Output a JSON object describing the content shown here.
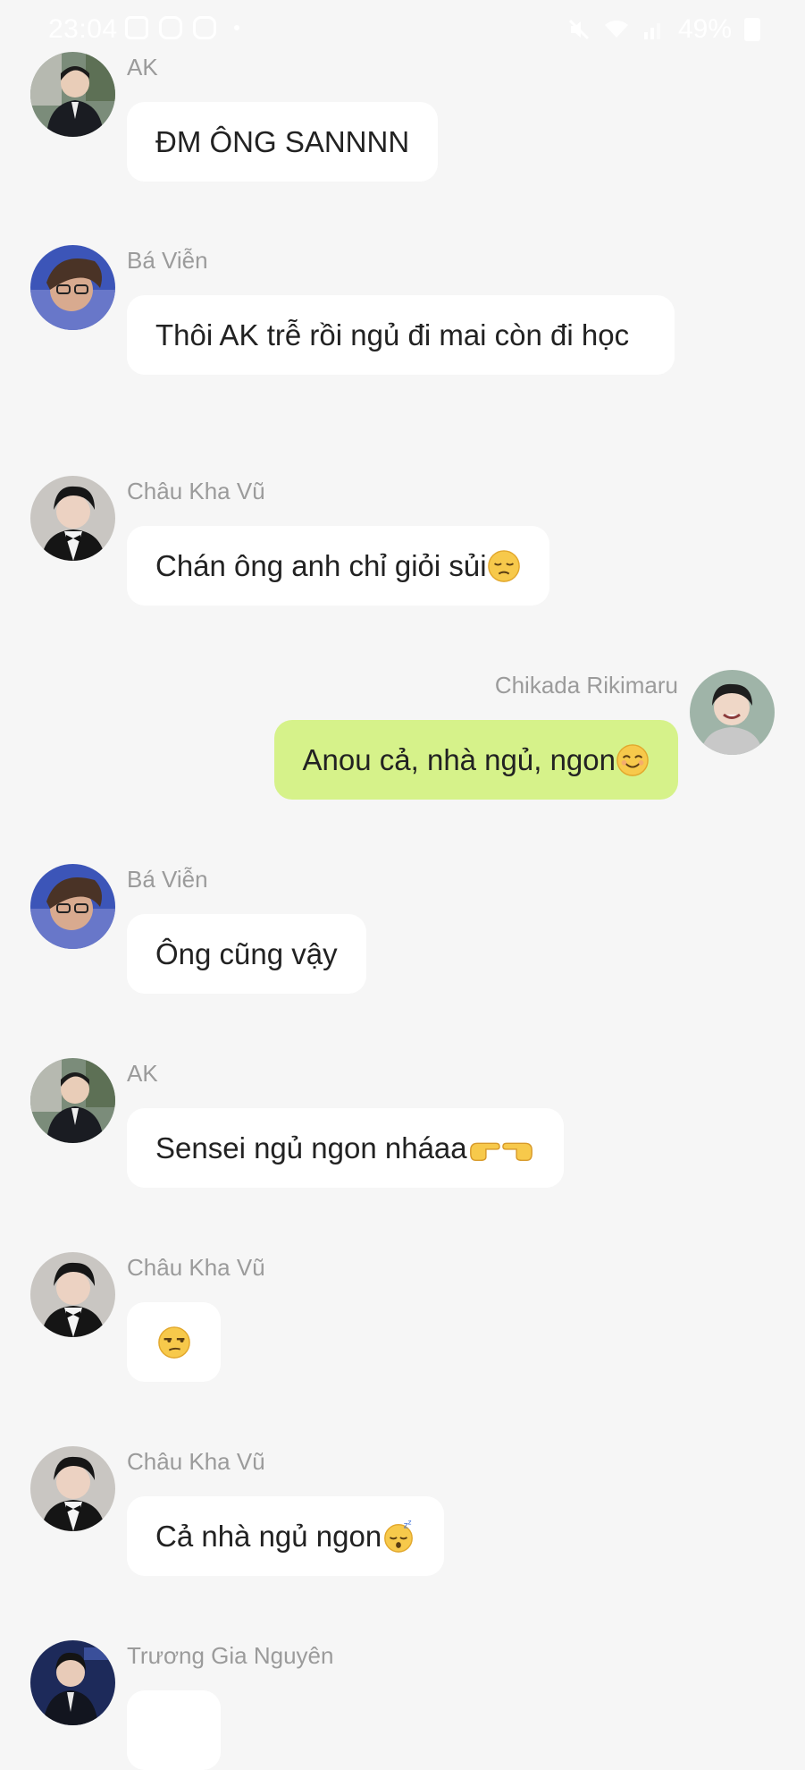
{
  "status_bar": {
    "time": "23:04",
    "battery": "49%",
    "icons_left": [
      "gallery-icon",
      "instagram-icon",
      "instagram-icon",
      "dot-icon"
    ],
    "icons_right": [
      "mute-icon",
      "wifi-icon",
      "signal-icon",
      "battery-icon"
    ]
  },
  "colors": {
    "background": "#f6f6f6",
    "bubble_incoming": "#ffffff",
    "bubble_outgoing": "#d6f28a",
    "sender_name": "#9b9b9b",
    "text": "#222222"
  },
  "messages": [
    {
      "sender": "AK",
      "side": "left",
      "text": "ĐM ÔNG SANNNN"
    },
    {
      "sender": "Bá Viễn",
      "side": "left",
      "text": "Thôi AK trễ rồi ngủ đi mai còn đi học"
    },
    {
      "sender": "Châu Kha Vũ",
      "side": "left",
      "text": "Chán ông anh chỉ giỏi sủi",
      "emoji": "pensive-face-emoji"
    },
    {
      "sender": "Chikada Rikimaru",
      "side": "right",
      "text": "Anou cả, nhà ngủ, ngon",
      "emoji": "smiling-face-emoji"
    },
    {
      "sender": "Bá Viễn",
      "side": "left",
      "text": "Ông cũng vậy"
    },
    {
      "sender": "AK",
      "side": "left",
      "text": "Sensei ngủ ngon nháaa",
      "emoji": "pointing-hands-emoji"
    },
    {
      "sender": "Châu Kha Vũ",
      "side": "left",
      "text": "",
      "emoji": "unamused-face-emoji"
    },
    {
      "sender": "Châu Kha Vũ",
      "side": "left",
      "text": "Cả nhà ngủ ngon",
      "emoji": "sleeping-face-emoji"
    },
    {
      "sender": "Trương Gia Nguyên",
      "side": "left",
      "text": ""
    }
  ]
}
